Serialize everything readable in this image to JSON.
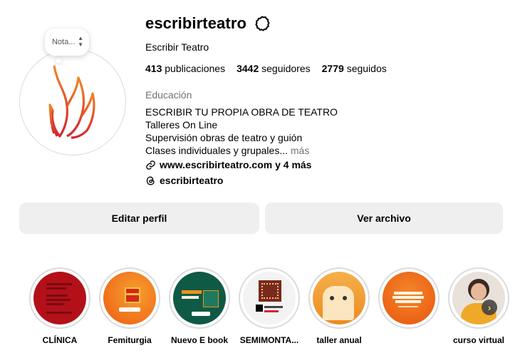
{
  "profile": {
    "username": "escribirteatro",
    "full_name": "Escribir Teatro",
    "stats": {
      "posts_count": "413",
      "posts_label": "publicaciones",
      "followers_count": "3442",
      "followers_label": "seguidores",
      "following_count": "2779",
      "following_label": "seguidos"
    },
    "category": "Educación",
    "bio": {
      "line1": "ESCRIBIR TU PROPIA OBRA DE TEATRO",
      "line2": "Talleres On Line",
      "line3": "Supervisión obras de teatro y guión",
      "line4": "Clases individuales y grupales...",
      "more": " más"
    },
    "link": "www.escribirteatro.com y 4 más",
    "threads_handle": "escribirteatro",
    "note_placeholder": "Nota..."
  },
  "buttons": {
    "edit_profile": "Editar perfil",
    "view_archive": "Ver archivo"
  },
  "highlights": [
    {
      "label": "CLÍNICA",
      "color": "#b3101a"
    },
    {
      "label": "Femiturgia",
      "color": "#f07a1a"
    },
    {
      "label": "Nuevo E book",
      "color": "#0f5a45"
    },
    {
      "label": "SEMIMONTA...",
      "color": "#f3f3f3"
    },
    {
      "label": "taller anual",
      "color": "#f0a035"
    },
    {
      "label": "",
      "color": "#ee6a14"
    },
    {
      "label": "curso virtual",
      "color": "#e8e2da"
    }
  ],
  "icons": {
    "settings": "gear-icon",
    "link": "link-icon",
    "threads": "threads-icon",
    "next": "chevron-right-icon"
  },
  "colors": {
    "brand_red": "#d3262f",
    "brand_orange": "#f0872a",
    "button_bg": "#efefef",
    "secondary_text": "#737373"
  }
}
